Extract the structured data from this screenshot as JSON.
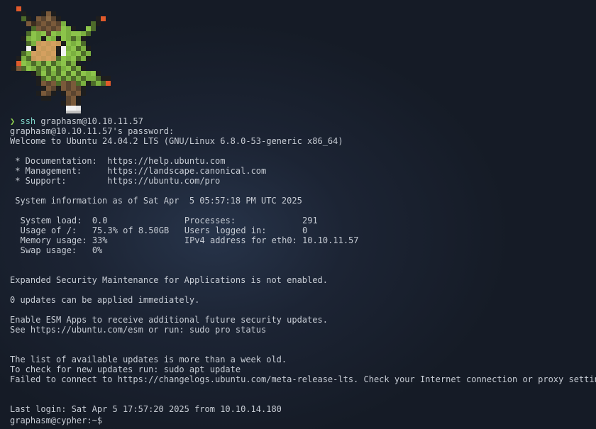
{
  "terminal": {
    "prompt_symbol": "❯",
    "ssh_command": "ssh",
    "ssh_args": "graphasm@10.10.11.57",
    "password_prompt": "graphasm@10.10.11.57's password:",
    "welcome": "Welcome to Ubuntu 24.04.2 LTS (GNU/Linux 6.8.0-53-generic x86_64)",
    "links": [
      {
        "label": " * Documentation:  ",
        "url": "https://help.ubuntu.com"
      },
      {
        "label": " * Management:     ",
        "url": "https://landscape.canonical.com"
      },
      {
        "label": " * Support:        ",
        "url": "https://ubuntu.com/pro"
      }
    ],
    "sysinfo_header": " System information as of Sat Apr  5 05:57:18 PM UTC 2025",
    "sysinfo_rows": [
      "   System load:  0.0               Processes:             291",
      "   Usage of /:   75.3% of 8.50GB   Users logged in:       0",
      "   Memory usage: 33%               IPv4 address for eth0: 10.10.11.57",
      "   Swap usage:   0%"
    ],
    "esm_notice": "Expanded Security Maintenance for Applications is not enabled.",
    "updates_notice": "0 updates can be applied immediately.",
    "esm_enable": "Enable ESM Apps to receive additional future security updates.",
    "esm_see": "See https://ubuntu.com/esm or run: sudo pro status",
    "list_old": "The list of available updates is more than a week old.",
    "check_updates": "To check for new updates run: sudo apt update",
    "failed_connect": "Failed to connect to https://changelogs.ubuntu.com/meta-release-lts. Check your Internet connection or proxy settings",
    "last_login": "Last login: Sat Apr 5 17:57:20 2025 from 10.10.14.180",
    "shell_prompt": "graphasm@cypher:~$"
  },
  "colors": {
    "background": "#1c2434",
    "text": "#c7ccd4",
    "prompt_arrow": "#8fd14f",
    "command": "#7fd4c8"
  },
  "art": {
    "icon": "chespin-pixel-art"
  }
}
